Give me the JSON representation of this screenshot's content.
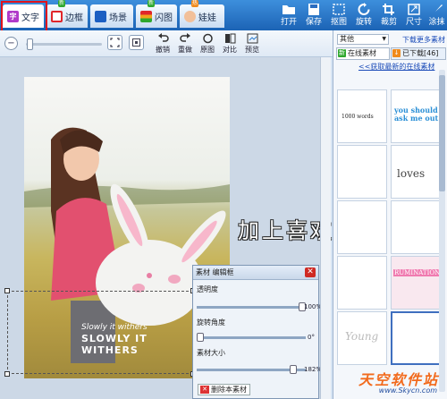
{
  "tabs": [
    {
      "label": "文字",
      "badge": "",
      "color": "#b03ac9",
      "glyph": "字"
    },
    {
      "label": "边框",
      "badge": "新",
      "color": "#e0262a",
      "glyph": ""
    },
    {
      "label": "场景",
      "badge": "",
      "color": "#1c5fc2",
      "glyph": ""
    },
    {
      "label": "闪图",
      "badge": "新",
      "color": "#f0a31c",
      "glyph": ""
    },
    {
      "label": "娃娃",
      "badge": "热",
      "color": "#f28a1e",
      "glyph": ""
    }
  ],
  "tools": [
    {
      "label": "打开",
      "icon": "folder-icon"
    },
    {
      "label": "保存",
      "icon": "save-icon"
    },
    {
      "label": "抠图",
      "icon": "cutout-icon"
    },
    {
      "label": "旋转",
      "icon": "rotate-icon"
    },
    {
      "label": "裁剪",
      "icon": "crop-icon"
    },
    {
      "label": "尺寸",
      "icon": "resize-icon"
    },
    {
      "label": "涂抹",
      "icon": "brush-icon"
    }
  ],
  "subtools": [
    {
      "label": "撤销",
      "icon": "undo-icon"
    },
    {
      "label": "重做",
      "icon": "redo-icon"
    },
    {
      "label": "原图",
      "icon": "original-icon"
    },
    {
      "label": "对比",
      "icon": "compare-icon"
    },
    {
      "label": "预览",
      "icon": "preview-icon"
    }
  ],
  "canvas": {
    "banner_text": "加上喜欢的文字",
    "sticker_line1": "Slowly it withers",
    "sticker_line2": "SLOWLY IT WITHERS"
  },
  "edit_panel": {
    "title": "素材 编辑框",
    "close_glyph": "✕",
    "controls": [
      {
        "label": "透明度",
        "value": "100%",
        "level": 1.0
      },
      {
        "label": "旋转角度",
        "value": "0°",
        "level": 0.0
      },
      {
        "label": "素材大小",
        "value": "182%",
        "level": 0.91
      }
    ],
    "delete_label": "删除本素材"
  },
  "right_panel": {
    "category": "其他",
    "download_more": "下载更多素材",
    "tab_online": "在线素材",
    "tab_downloaded": "已下载[46]",
    "get_new": "<<获取最新的在线素材",
    "thumbs": [
      {
        "text": "1000 words",
        "color": "#222"
      },
      {
        "text": "you should ask me out",
        "color": "#2a8fd6"
      },
      {
        "text": "",
        "color": "#aaa"
      },
      {
        "text": "loves",
        "color": "#444"
      },
      {
        "text": "",
        "color": "#999"
      },
      {
        "text": "",
        "color": "#999"
      },
      {
        "text": "",
        "color": "#e25a8a"
      },
      {
        "text": "RUMINATION",
        "color": "#f07bb0"
      },
      {
        "text": "Young",
        "color": "#bbb"
      },
      {
        "text": "",
        "color": "#3f6fbf"
      }
    ]
  },
  "watermark": {
    "cn": "天空软件站",
    "url": "www.Skycn.com"
  }
}
